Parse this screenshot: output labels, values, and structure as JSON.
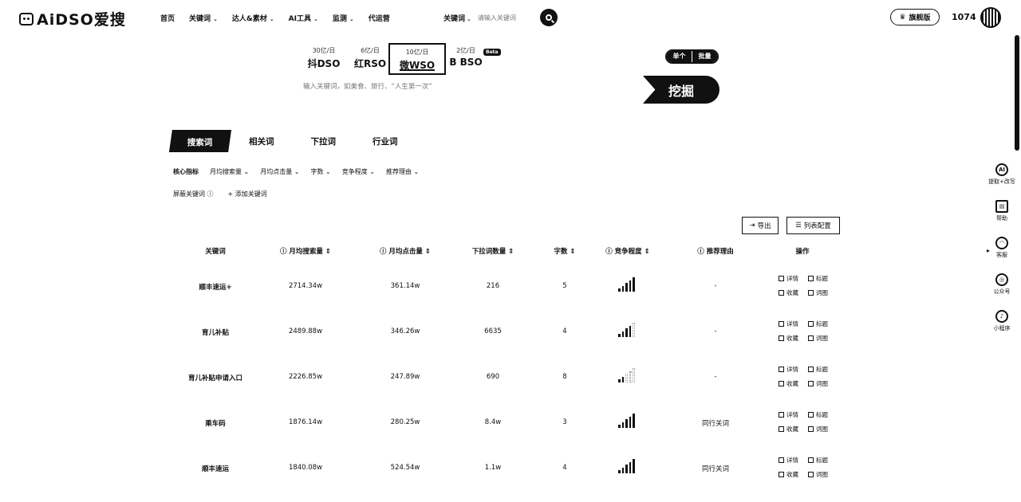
{
  "brand": {
    "name": "AiDSO爱搜"
  },
  "nav": [
    {
      "label": "首页",
      "caret": false
    },
    {
      "label": "关键词",
      "caret": true
    },
    {
      "label": "达人&素材",
      "caret": true
    },
    {
      "label": "AI工具",
      "caret": true
    },
    {
      "label": "监测",
      "caret": true
    },
    {
      "label": "代运营",
      "caret": false
    }
  ],
  "header_search": {
    "select": "关键词",
    "placeholder": "请输入关键词"
  },
  "vip_label": "旗舰版",
  "credits": "1074",
  "engines": [
    {
      "count": "30亿/日",
      "name": "抖DSO",
      "active": false
    },
    {
      "count": "6亿/日",
      "name": "红RSO",
      "active": false
    },
    {
      "count": "10亿/日",
      "name": "微WSO",
      "active": true
    },
    {
      "count": "2亿/日",
      "name": "B BSO",
      "active": false
    }
  ],
  "beta_label": "Beta",
  "main_search": {
    "placeholder": "输入关键词，如美食、旅行、“人生第一次”"
  },
  "mode": {
    "single": "单个",
    "batch": "批量"
  },
  "dig_button": "挖掘",
  "subtabs": [
    "搜索词",
    "相关词",
    "下拉词",
    "行业词"
  ],
  "filters": [
    "核心指标",
    "月均搜索量",
    "月均点击量",
    "字数",
    "竞争程度",
    "推荐理由"
  ],
  "filters2": {
    "exclude": "屏蔽关键词",
    "add": "+ 添加关键词"
  },
  "tools": {
    "export": "导出",
    "columns": "列表配置"
  },
  "columns": [
    "关键词",
    "月均搜索量",
    "月均点击量",
    "下拉词数量",
    "字数",
    "竞争程度",
    "推荐理由",
    "操作"
  ],
  "rows": [
    {
      "keyword": "顺丰速运+",
      "search": "2714.34w",
      "clicks": "361.14w",
      "dropdown": "216",
      "chars": "5",
      "competition": 5,
      "reason": "-"
    },
    {
      "keyword": "育儿补贴",
      "search": "2489.88w",
      "clicks": "346.26w",
      "dropdown": "6635",
      "chars": "4",
      "competition": 4,
      "reason": "-"
    },
    {
      "keyword": "育儿补贴申请入口",
      "search": "2226.85w",
      "clicks": "247.89w",
      "dropdown": "690",
      "chars": "8",
      "competition": 2,
      "reason": "-"
    },
    {
      "keyword": "乘车码",
      "search": "1876.14w",
      "clicks": "280.25w",
      "dropdown": "8.4w",
      "chars": "3",
      "competition": 5,
      "reason": "同行关词"
    },
    {
      "keyword": "顺丰速运",
      "search": "1840.08w",
      "clicks": "524.54w",
      "dropdown": "1.1w",
      "chars": "4",
      "competition": 5,
      "reason": "同行关词"
    }
  ],
  "row_actions": {
    "detail": "详情",
    "tag": "标题",
    "favorite": "收藏",
    "chart": "词图"
  },
  "sidebar": [
    {
      "icon": "ai-icon",
      "label": "提取+改写"
    },
    {
      "icon": "book-icon",
      "label": "帮助"
    },
    {
      "icon": "headset-icon",
      "label": "客服"
    },
    {
      "icon": "wechat-icon",
      "label": "公众号"
    },
    {
      "icon": "miniprogram-icon",
      "label": "小程序"
    }
  ]
}
